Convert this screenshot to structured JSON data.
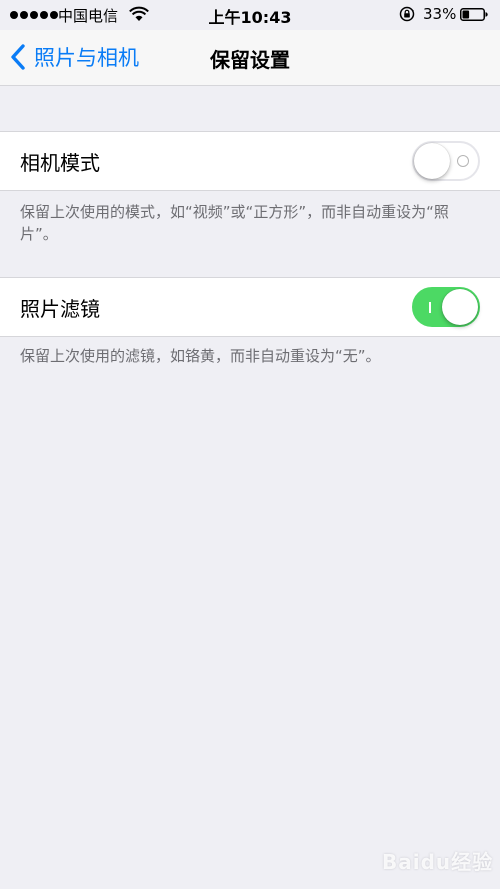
{
  "status_bar": {
    "carrier": "中国电信",
    "time": "上午10:43",
    "battery_percent": "33%",
    "battery_level": 0.33,
    "icons": [
      "signal-dots-icon",
      "wifi-icon",
      "rotation-lock-icon",
      "battery-icon"
    ]
  },
  "nav": {
    "back_label": "照片与相机",
    "title": "保留设置",
    "accent_color": "#0a7cf6"
  },
  "settings": [
    {
      "label": "相机模式",
      "enabled": false,
      "footer": "保留上次使用的模式，如“视频”或“正方形”，而非自动重设为“照片”。"
    },
    {
      "label": "照片滤镜",
      "enabled": true,
      "footer": "保留上次使用的滤镜，如铬黄，而非自动重设为“无”。"
    }
  ],
  "colors": {
    "background": "#efeff4",
    "toggle_on": "#4cd964",
    "footer_text": "#6d6d72"
  },
  "watermark": "Baidu经验"
}
